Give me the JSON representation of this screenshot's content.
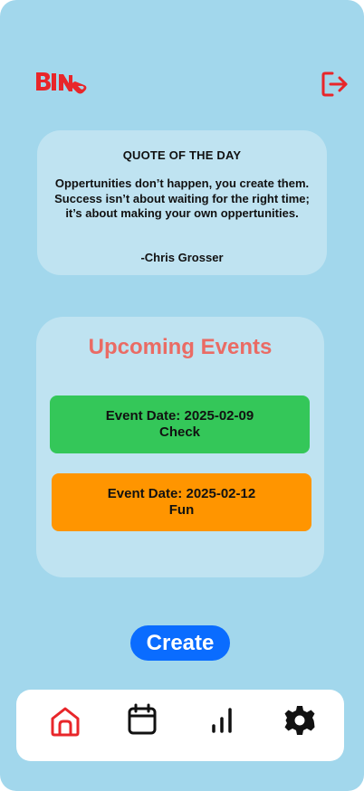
{
  "app": {
    "logo_text": "BINO",
    "accent_color": "#e8262a",
    "background_color": "#a2d7ec"
  },
  "header": {
    "logout_icon": "logout-icon"
  },
  "quote": {
    "heading": "QUOTE OF THE DAY",
    "text": "Oppertunities don’t happen, you create them. Success isn’t about waiting for the right time; it’s about making your own oppertunities.",
    "author": "-Chris Grosser"
  },
  "events": {
    "title": "Upcoming Events",
    "items": [
      {
        "date_line": "Event Date: 2025-02-09",
        "name": "Check",
        "color": "#34c759"
      },
      {
        "date_line": "Event Date: 2025-02-12",
        "name": "Fun",
        "color": "#ff9500"
      }
    ]
  },
  "create_button": {
    "label": "Create",
    "color": "#0a6cff"
  },
  "tabbar": {
    "items": [
      {
        "icon": "home-icon",
        "active": true,
        "color": "#e8262a"
      },
      {
        "icon": "calendar-icon",
        "active": false,
        "color": "#111111"
      },
      {
        "icon": "stats-icon",
        "active": false,
        "color": "#111111"
      },
      {
        "icon": "settings-icon",
        "active": false,
        "color": "#111111"
      }
    ]
  }
}
